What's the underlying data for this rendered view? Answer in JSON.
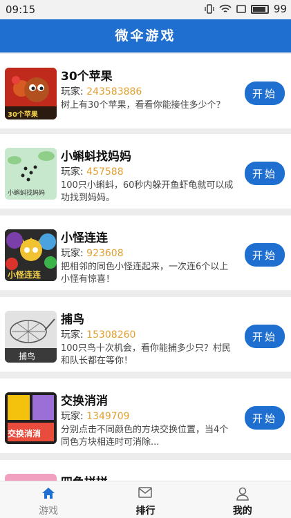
{
  "status_bar": {
    "time": "09:15",
    "battery": "99"
  },
  "header": {
    "title": "微伞游戏"
  },
  "player_label": "玩家:",
  "play_label": "开始",
  "games": [
    {
      "title": "30个苹果",
      "players": "243583886",
      "desc": "树上有30个苹果，看看你能接住多少个？",
      "thumb_text": "30个苹果",
      "icon": "apple-squirrel-icon"
    },
    {
      "title": "小蝌蚪找妈妈",
      "players": "457588",
      "desc": "100只小蝌蚪，60秒内躲开鱼虾龟就可以成功找到妈妈。",
      "thumb_text": "小蝌蚪找妈妈",
      "icon": "tadpole-icon"
    },
    {
      "title": "小怪连连",
      "players": "923608",
      "desc": "把相邻的同色小怪连起来，一次连6个以上小怪有惊喜！",
      "thumb_text": "小怪连连",
      "icon": "monster-icon"
    },
    {
      "title": "捕鸟",
      "players": "15308260",
      "desc": "100只鸟十次机会，看你能捕多少只？村民和队长都在等你！",
      "thumb_text": "捕鸟",
      "icon": "bird-net-icon"
    },
    {
      "title": "交换消消",
      "players": "1349709",
      "desc": "分别点击不同颜色的方块交换位置，当4个同色方块相连时可消除...",
      "thumb_text": "交换消消",
      "icon": "color-blocks-icon"
    },
    {
      "title": "四色拼拼"
    }
  ],
  "tabs": [
    {
      "label": "游戏",
      "icon": "home-icon"
    },
    {
      "label": "排行",
      "icon": "mail-icon"
    },
    {
      "label": "我的",
      "icon": "person-icon"
    }
  ],
  "colors": {
    "accent": "#1f6fd1",
    "players_num": "#e0a030"
  }
}
